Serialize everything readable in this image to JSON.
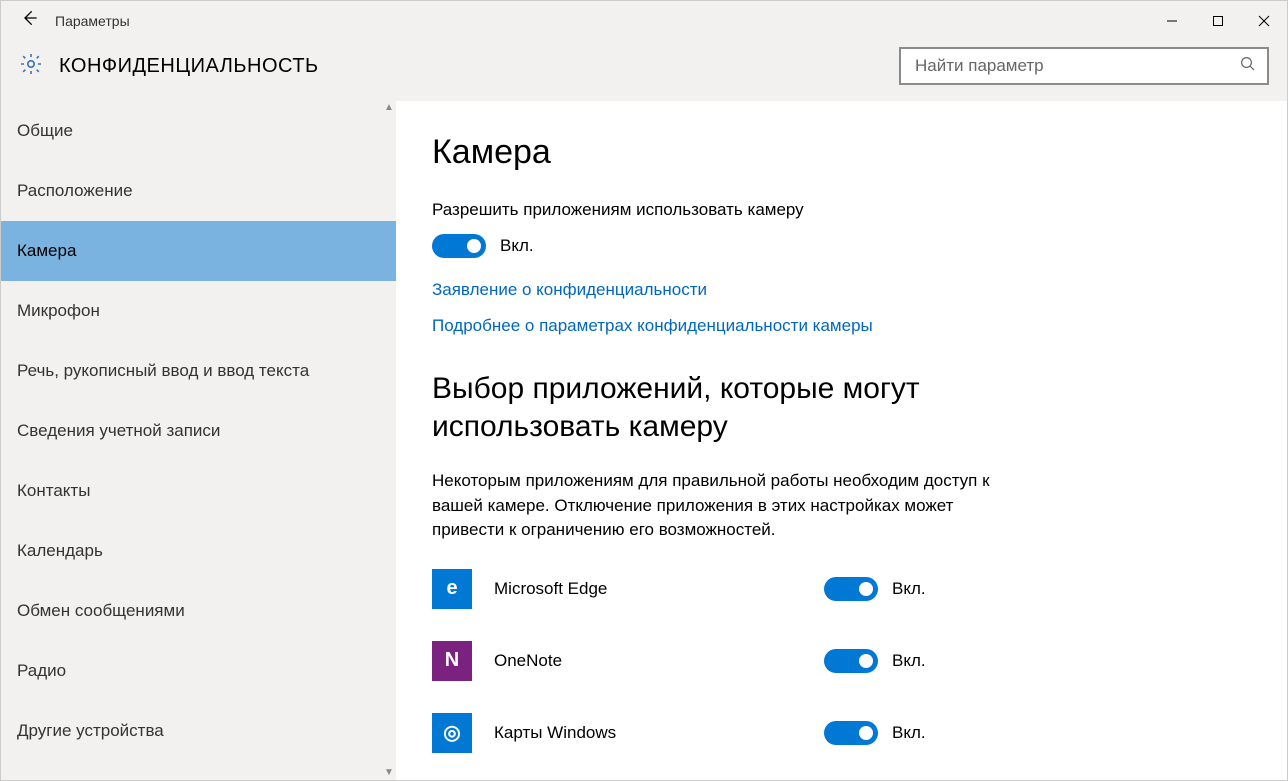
{
  "titlebar": {
    "title": "Параметры"
  },
  "header": {
    "title": "КОНФИДЕНЦИАЛЬНОСТЬ"
  },
  "search": {
    "placeholder": "Найти параметр"
  },
  "sidebar": {
    "selected_index": 2,
    "items": [
      {
        "label": "Общие"
      },
      {
        "label": "Расположение"
      },
      {
        "label": "Камера"
      },
      {
        "label": "Микрофон"
      },
      {
        "label": "Речь, рукописный ввод и ввод текста"
      },
      {
        "label": "Сведения учетной записи"
      },
      {
        "label": "Контакты"
      },
      {
        "label": "Календарь"
      },
      {
        "label": "Обмен сообщениями"
      },
      {
        "label": "Радио"
      },
      {
        "label": "Другие устройства"
      }
    ]
  },
  "main": {
    "page_title": "Камера",
    "allow_label": "Разрешить приложениям использовать камеру",
    "allow_state": "Вкл.",
    "link1": "Заявление о конфиденциальности",
    "link2": "Подробнее о параметрах конфиденциальности камеры",
    "section_title": "Выбор приложений, которые могут использовать камеру",
    "section_desc": "Некоторым приложениям для правильной работы необходим доступ к вашей камере. Отключение приложения в этих настройках может привести к ограничению его возможностей.",
    "apps": [
      {
        "name": "Microsoft Edge",
        "state": "Вкл.",
        "color": "#0078d4",
        "glyph": "e"
      },
      {
        "name": "OneNote",
        "state": "Вкл.",
        "color": "#7b217f",
        "glyph": "N"
      },
      {
        "name": "Карты Windows",
        "state": "Вкл.",
        "color": "#0078d4",
        "glyph": "◎"
      }
    ]
  }
}
